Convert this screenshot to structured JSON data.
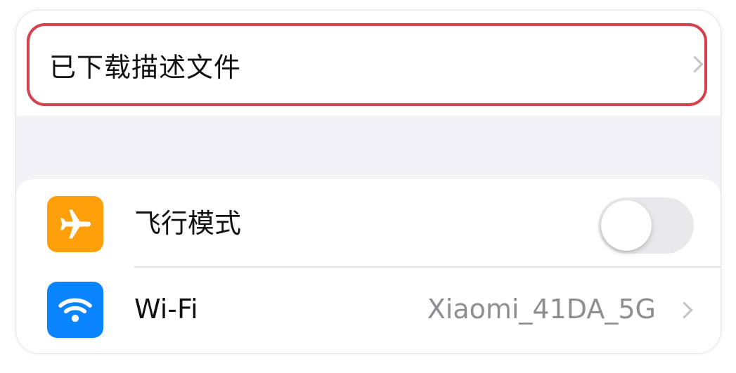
{
  "profile_row": {
    "label": "已下载描述文件",
    "highlight_color": "#d5414c"
  },
  "settings": {
    "airplane": {
      "label": "飞行模式",
      "icon": "airplane-icon",
      "icon_color": "#ff9f0a",
      "toggle_on": false
    },
    "wifi": {
      "label": "Wi-Fi",
      "value": "Xiaomi_41DA_5G",
      "icon": "wifi-icon",
      "icon_color": "#0a84ff"
    }
  }
}
